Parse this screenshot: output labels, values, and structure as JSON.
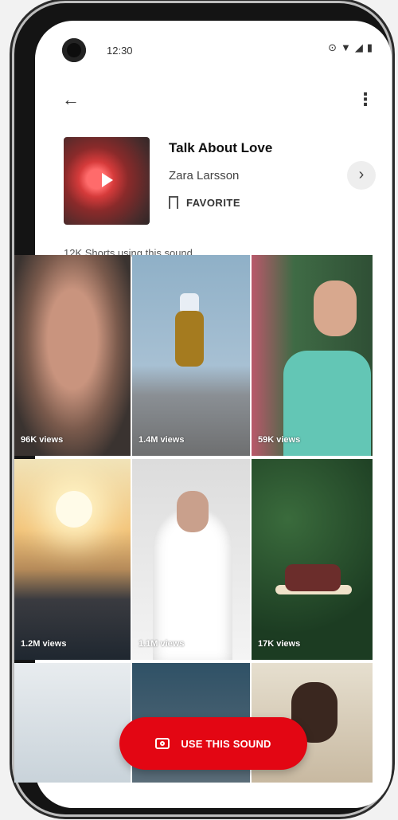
{
  "statusbar": {
    "time": "12:30",
    "icons": [
      "⊙",
      "▼",
      "◢",
      "▮"
    ]
  },
  "topbar": {
    "back_icon": "←",
    "more_icon": "⋮"
  },
  "sound": {
    "title": "Talk About Love",
    "artist": "Zara Larsson",
    "favorite_label": "FAVORITE",
    "chevron_icon": "›"
  },
  "shorts_count": "12K Shorts using this sound",
  "tiles": [
    {
      "views": "96K views"
    },
    {
      "views": "1.4M views"
    },
    {
      "views": "59K views"
    },
    {
      "views": "1.2M views"
    },
    {
      "views": "1.1M views"
    },
    {
      "views": "17K views"
    },
    {
      "views": ""
    },
    {
      "views": ""
    },
    {
      "views": ""
    }
  ],
  "cta": {
    "label": "USE THIS SOUND"
  },
  "colors": {
    "cta_red": "#e30613"
  }
}
